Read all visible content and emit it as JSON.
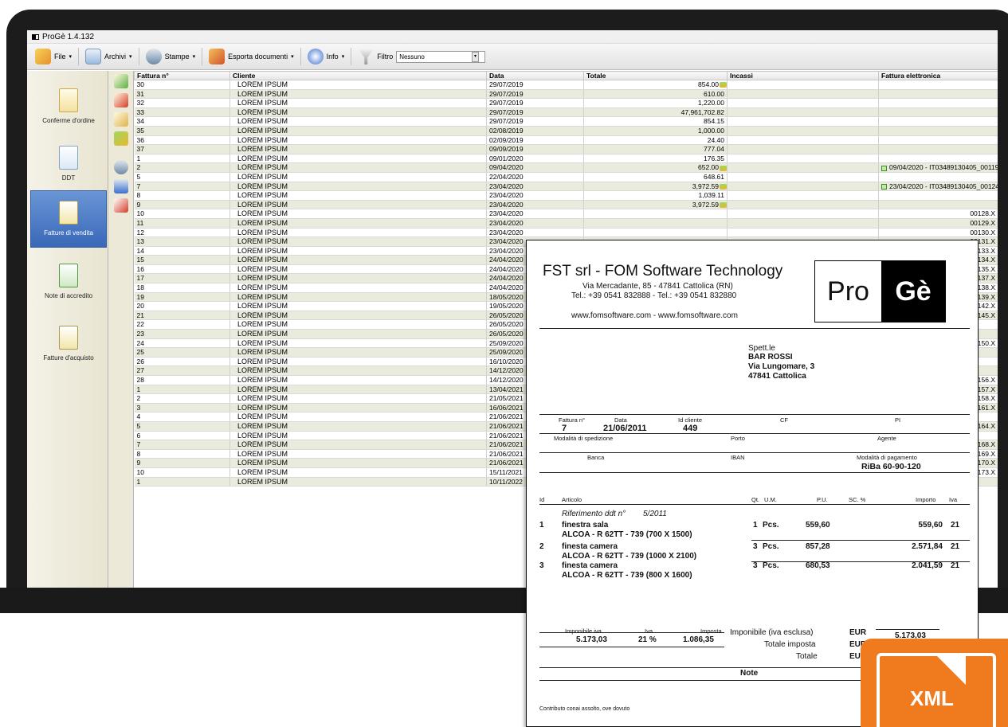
{
  "app": {
    "title": "ProGè 1.4.132",
    "toolbar": {
      "file_label": "File",
      "archivi_label": "Archivi",
      "stampe_label": "Stampe",
      "esporta_label": "Esporta documenti",
      "info_label": "Info",
      "filtro_label": "Filtro",
      "filtro_value": "Nessuno",
      "dropdown_arrow": "▾"
    },
    "sidebar": [
      {
        "label": "Conferme d'ordine"
      },
      {
        "label": "DDT"
      },
      {
        "label": "Fatture di vendita"
      },
      {
        "label": "Note di accredito"
      },
      {
        "label": "Fatture d'acquisto"
      }
    ],
    "grid": {
      "headers": {
        "fattura": "Fattura n°",
        "cliente": "Cliente",
        "data": "Data",
        "totale": "Totale",
        "incassi": "Incassi",
        "fe": "Fattura elettronica"
      },
      "rows": [
        {
          "n": "30",
          "cliente": "LOREM IPSUM",
          "data": "29/07/2019",
          "totale": "854.00",
          "inc": true,
          "fe": ""
        },
        {
          "n": "31",
          "cliente": "LOREM IPSUM",
          "data": "29/07/2019",
          "totale": "610.00",
          "inc": false,
          "fe": ""
        },
        {
          "n": "32",
          "cliente": "LOREM IPSUM",
          "data": "29/07/2019",
          "totale": "1,220.00",
          "inc": false,
          "fe": ""
        },
        {
          "n": "33",
          "cliente": "LOREM IPSUM",
          "data": "29/07/2019",
          "totale": "47,961,702.82",
          "inc": false,
          "fe": ""
        },
        {
          "n": "34",
          "cliente": "LOREM IPSUM",
          "data": "29/07/2019",
          "totale": "854.15",
          "inc": false,
          "fe": ""
        },
        {
          "n": "35",
          "cliente": "LOREM IPSUM",
          "data": "02/08/2019",
          "totale": "1,000.00",
          "inc": false,
          "fe": ""
        },
        {
          "n": "36",
          "cliente": "LOREM IPSUM",
          "data": "02/09/2019",
          "totale": "24.40",
          "inc": false,
          "fe": ""
        },
        {
          "n": "37",
          "cliente": "LOREM IPSUM",
          "data": "09/09/2019",
          "totale": "777.04",
          "inc": false,
          "fe": ""
        },
        {
          "n": "1",
          "cliente": "LOREM IPSUM",
          "data": "09/01/2020",
          "totale": "176.35",
          "inc": false,
          "fe": ""
        },
        {
          "n": "2",
          "cliente": "LOREM IPSUM",
          "data": "09/04/2020",
          "totale": "652.00",
          "inc": true,
          "fe": "09/04/2020 - IT03489130405_00119.X"
        },
        {
          "n": "5",
          "cliente": "LOREM IPSUM",
          "data": "22/04/2020",
          "totale": "648.61",
          "inc": false,
          "fe": ""
        },
        {
          "n": "7",
          "cliente": "LOREM IPSUM",
          "data": "23/04/2020",
          "totale": "3,972.59",
          "inc": true,
          "fe": "23/04/2020 - IT03489130405_00124.X"
        },
        {
          "n": "8",
          "cliente": "LOREM IPSUM",
          "data": "23/04/2020",
          "totale": "1,039.11",
          "inc": false,
          "fe": ""
        },
        {
          "n": "9",
          "cliente": "LOREM IPSUM",
          "data": "23/04/2020",
          "totale": "3,972.59",
          "inc": true,
          "fe": ""
        },
        {
          "n": "10",
          "cliente": "LOREM IPSUM",
          "data": "23/04/2020",
          "totale": "",
          "inc": false,
          "fe": "00128.X"
        },
        {
          "n": "11",
          "cliente": "LOREM IPSUM",
          "data": "23/04/2020",
          "totale": "",
          "inc": false,
          "fe": "00129.X"
        },
        {
          "n": "12",
          "cliente": "LOREM IPSUM",
          "data": "23/04/2020",
          "totale": "",
          "inc": false,
          "fe": "00130.X"
        },
        {
          "n": "13",
          "cliente": "LOREM IPSUM",
          "data": "23/04/2020",
          "totale": "",
          "inc": false,
          "fe": "00131.X"
        },
        {
          "n": "14",
          "cliente": "LOREM IPSUM",
          "data": "23/04/2020",
          "totale": "",
          "inc": false,
          "fe": "00133.X"
        },
        {
          "n": "15",
          "cliente": "LOREM IPSUM",
          "data": "24/04/2020",
          "totale": "",
          "inc": false,
          "fe": "00134.X"
        },
        {
          "n": "16",
          "cliente": "LOREM IPSUM",
          "data": "24/04/2020",
          "totale": "",
          "inc": false,
          "fe": "00135.X"
        },
        {
          "n": "17",
          "cliente": "LOREM IPSUM",
          "data": "24/04/2020",
          "totale": "",
          "inc": false,
          "fe": "00137.X"
        },
        {
          "n": "18",
          "cliente": "LOREM IPSUM",
          "data": "24/04/2020",
          "totale": "",
          "inc": false,
          "fe": "00138.X"
        },
        {
          "n": "19",
          "cliente": "LOREM IPSUM",
          "data": "18/05/2020",
          "totale": "",
          "inc": false,
          "fe": "00139.X"
        },
        {
          "n": "20",
          "cliente": "LOREM IPSUM",
          "data": "19/05/2020",
          "totale": "",
          "inc": false,
          "fe": "00142.X"
        },
        {
          "n": "21",
          "cliente": "LOREM IPSUM",
          "data": "26/05/2020",
          "totale": "",
          "inc": false,
          "fe": "00145.X"
        },
        {
          "n": "22",
          "cliente": "LOREM IPSUM",
          "data": "26/05/2020",
          "totale": "",
          "inc": false,
          "fe": ""
        },
        {
          "n": "23",
          "cliente": "LOREM IPSUM",
          "data": "26/05/2020",
          "totale": "",
          "inc": false,
          "fe": ""
        },
        {
          "n": "24",
          "cliente": "LOREM IPSUM",
          "data": "25/09/2020",
          "totale": "",
          "inc": false,
          "fe": "00150.X"
        },
        {
          "n": "25",
          "cliente": "LOREM IPSUM",
          "data": "25/09/2020",
          "totale": "",
          "inc": false,
          "fe": ""
        },
        {
          "n": "26",
          "cliente": "LOREM IPSUM",
          "data": "16/10/2020",
          "totale": "",
          "inc": false,
          "fe": ""
        },
        {
          "n": "27",
          "cliente": "LOREM IPSUM",
          "data": "14/12/2020",
          "totale": "",
          "inc": false,
          "fe": ""
        },
        {
          "n": "28",
          "cliente": "LOREM IPSUM",
          "data": "14/12/2020",
          "totale": "",
          "inc": false,
          "fe": "00156.X"
        },
        {
          "n": "1",
          "cliente": "LOREM IPSUM",
          "data": "13/04/2021",
          "totale": "",
          "inc": false,
          "fe": "00157.X"
        },
        {
          "n": "2",
          "cliente": "LOREM IPSUM",
          "data": "21/05/2021",
          "totale": "",
          "inc": false,
          "fe": "00158.X"
        },
        {
          "n": "3",
          "cliente": "LOREM IPSUM",
          "data": "16/06/2021",
          "totale": "",
          "inc": false,
          "fe": "00161.X"
        },
        {
          "n": "4",
          "cliente": "LOREM IPSUM",
          "data": "21/06/2021",
          "totale": "",
          "inc": false,
          "fe": ""
        },
        {
          "n": "5",
          "cliente": "LOREM IPSUM",
          "data": "21/06/2021",
          "totale": "",
          "inc": false,
          "fe": "00164.X"
        },
        {
          "n": "6",
          "cliente": "LOREM IPSUM",
          "data": "21/06/2021",
          "totale": "",
          "inc": false,
          "fe": ""
        },
        {
          "n": "7",
          "cliente": "LOREM IPSUM",
          "data": "21/06/2021",
          "totale": "",
          "inc": false,
          "fe": "00168.X"
        },
        {
          "n": "8",
          "cliente": "LOREM IPSUM",
          "data": "21/06/2021",
          "totale": "",
          "inc": false,
          "fe": "00169.X"
        },
        {
          "n": "9",
          "cliente": "LOREM IPSUM",
          "data": "21/06/2021",
          "totale": "",
          "inc": false,
          "fe": "00170.X"
        },
        {
          "n": "10",
          "cliente": "LOREM IPSUM",
          "data": "15/11/2021",
          "totale": "",
          "inc": false,
          "fe": "00173.X"
        },
        {
          "n": "1",
          "cliente": "LOREM IPSUM",
          "data": "10/11/2022",
          "totale": "",
          "inc": false,
          "fe": ""
        }
      ]
    }
  },
  "invoice": {
    "company": "FST srl - FOM Software Technology",
    "address": "Via Mercadante, 85 - 47841 Cattolica (RN)",
    "phones": "Tel.: +39 0541 832888 - Tel.: +39 0541 832880",
    "websites": "www.fomsoftware.com - www.fomsoftware.com",
    "logo_left": "Pro",
    "logo_right": "Gè",
    "recipient_label": "Spett.le",
    "recipient_name": "BAR ROSSI",
    "recipient_street": "Via Lungomare, 3",
    "recipient_city": "47841 Cattolica",
    "head": {
      "fattura_label": "Fattura n°",
      "fattura_value": "7",
      "data_label": "Data",
      "data_value": "21/06/2011",
      "cliente_label": "Id cliente",
      "cliente_value": "449",
      "cf_label": "CF",
      "pi_label": "PI",
      "spedizione_label": "Modalità di spedizione",
      "porto_label": "Porto",
      "agente_label": "Agente",
      "banca_label": "Banca",
      "iban_label": "IBAN",
      "pagamento_label": "Modalità di pagamento",
      "pagamento_value": "RiBa 60-90-120"
    },
    "columns": {
      "id": "Id",
      "articolo": "Articolo",
      "qt": "Qt.",
      "um": "U.M.",
      "pu": "P.U.",
      "sc": "SC. %",
      "importo": "Importo",
      "iva": "Iva"
    },
    "reference": "Riferimento ddt n°",
    "reference_value": "5/2011",
    "items": [
      {
        "id": "1",
        "desc": "finestra sala",
        "code": "ALCOA - R 62TT - 739 (700 X 1500)",
        "qt": "1",
        "um": "Pcs.",
        "pu": "559,60",
        "importo": "559,60",
        "iva": "21"
      },
      {
        "id": "2",
        "desc": "finesta camera",
        "code": "ALCOA - R 62TT - 739 (1000 X 2100)",
        "qt": "3",
        "um": "Pcs.",
        "pu": "857,28",
        "importo": "2.571,84",
        "iva": "21"
      },
      {
        "id": "3",
        "desc": "finesta camera",
        "code": "ALCOA - R 62TT - 739 (800 X 1600)",
        "qt": "3",
        "um": "Pcs.",
        "pu": "680,53",
        "importo": "2.041,59",
        "iva": "21"
      }
    ],
    "totals": {
      "imponibile_iva_label": "Imponibile iva",
      "iva_label": "Iva",
      "imposta_label": "Imposta",
      "imponibile_iva_value": "5.173,03",
      "iva_value": "21 %",
      "imposta_value": "1.086,35",
      "imponibile_esclusa_label": "Imponibile (iva esclusa)",
      "totale_imposta_label": "Totale imposta",
      "totale_label": "Totale",
      "eur": "EUR",
      "imponibile_esclusa_value": "5.173,03"
    },
    "note_label": "Note",
    "footer": "Contributo conai assolto, ove dovuto"
  },
  "xml_badge": {
    "label": "XML",
    "color": "#f07a1e"
  }
}
